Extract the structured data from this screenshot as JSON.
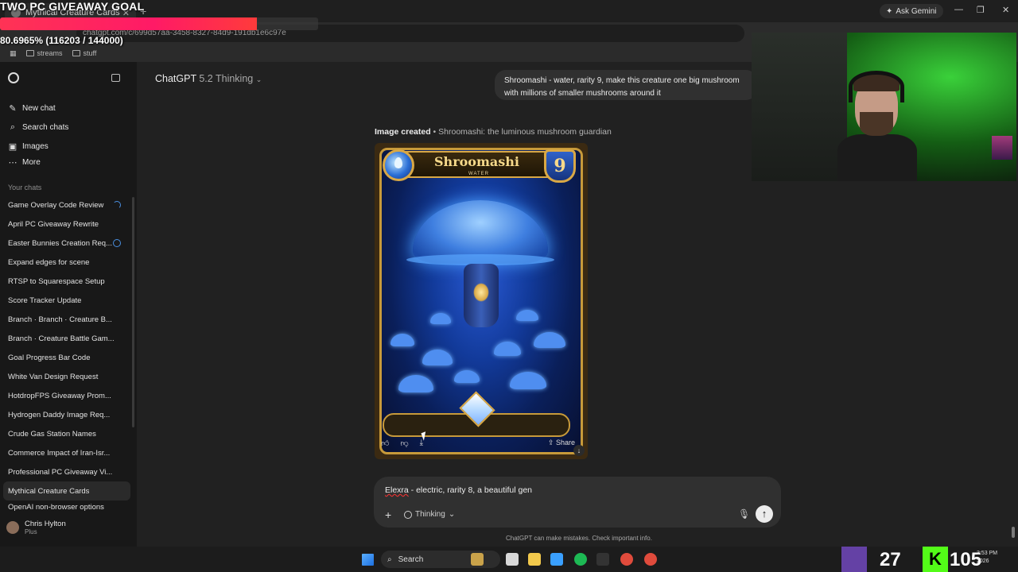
{
  "overlay": {
    "title": "TWO PC GIVEAWAY GOAL",
    "progress_text": "80.6965% (116203 / 144000)",
    "progress_fraction": 0.806965,
    "bar_color": "#ff2255"
  },
  "browser": {
    "tab_title": "Mythical Creature Cards",
    "ask_gemini": "Ask Gemini",
    "url": "chatgpt.com/c/699d57aa-3458-8327-84d9-191db1e6c97e",
    "bookmarks": [
      "streams",
      "stuff"
    ]
  },
  "sidebar": {
    "nav": [
      {
        "label": "New chat",
        "icon": "edit-icon"
      },
      {
        "label": "Search chats",
        "icon": "search-icon"
      },
      {
        "label": "Images",
        "icon": "image-icon"
      },
      {
        "label": "More",
        "icon": "more-icon"
      }
    ],
    "chats_heading": "Your chats",
    "chats": [
      "Game Overlay Code Review",
      "April PC Giveaway Rewrite",
      "Easter Bunnies Creation Req...",
      "Expand edges for scene",
      "RTSP to Squarespace Setup",
      "Score Tracker Update",
      "Branch · Branch · Creature B...",
      "Branch · Creature Battle Gam...",
      "Goal Progress Bar Code",
      "White Van Design Request",
      "HotdropFPS Giveaway Prom...",
      "Hydrogen Daddy Image Req...",
      "Crude Gas Station Names",
      "Commerce Impact of Iran-Isr...",
      "Professional PC Giveaway Vi...",
      "Mythical Creature Cards",
      "OpenAI non-browser options"
    ],
    "active_chat_index": 15,
    "user": {
      "name": "Chris Hylton",
      "plan": "Plus"
    }
  },
  "main": {
    "model_name": "ChatGPT",
    "model_version": "5.2 Thinking",
    "user_message": "Shroomashi - water, rarity 9, make this creature one big mushroom with millions of smaller mushrooms around it",
    "image_caption_bold": "Image created",
    "image_caption_rest": " • Shroomashi: the luminous mushroom guardian",
    "card": {
      "name": "Shroomashi",
      "element": "WATER",
      "rarity": "9"
    },
    "share_label": "Share",
    "composer_text_spell": "Elexra",
    "composer_text_rest": " - electric, rarity 8, a beautiful gen",
    "thinking_label": "Thinking",
    "disclaimer": "ChatGPT can make mistakes. Check important info."
  },
  "taskbar": {
    "search_label": "Search",
    "viewer_count": "27",
    "kick_count": "105",
    "clock_time": "3:53 PM",
    "clock_year": "2026"
  }
}
